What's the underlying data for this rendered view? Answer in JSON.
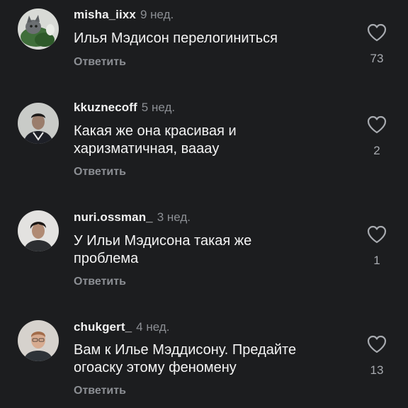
{
  "comments": [
    {
      "username": "misha_iixx",
      "time": "9 нед.",
      "text": "Илья Мэдисон перелогиниться",
      "reply_label": "Ответить",
      "likes": "73",
      "avatar": "cat-avatar"
    },
    {
      "username": "kkuznecoff",
      "time": "5 нед.",
      "text": "Какая же она красивая и харизматичная, ваааy",
      "reply_label": "Ответить",
      "likes": "2",
      "avatar": "user-photo-avatar"
    },
    {
      "username": "nuri.ossman_",
      "time": "3 нед.",
      "text": "У Ильи Мэдисона такая же проблема",
      "reply_label": "Ответить",
      "likes": "1",
      "avatar": "user-photo-avatar"
    },
    {
      "username": "chukgert_",
      "time": "4 нед.",
      "text": "Вам к Илье Мэддисону. Предайте огоаску этому феномену",
      "reply_label": "Ответить",
      "likes": "13",
      "avatar": "user-photo-avatar"
    }
  ],
  "colors": {
    "background": "#1c1d1f",
    "text": "#f4f4f4",
    "muted": "#8c8f94",
    "icon": "#a8abb0"
  },
  "icons": {
    "like": "heart-outline-icon"
  }
}
